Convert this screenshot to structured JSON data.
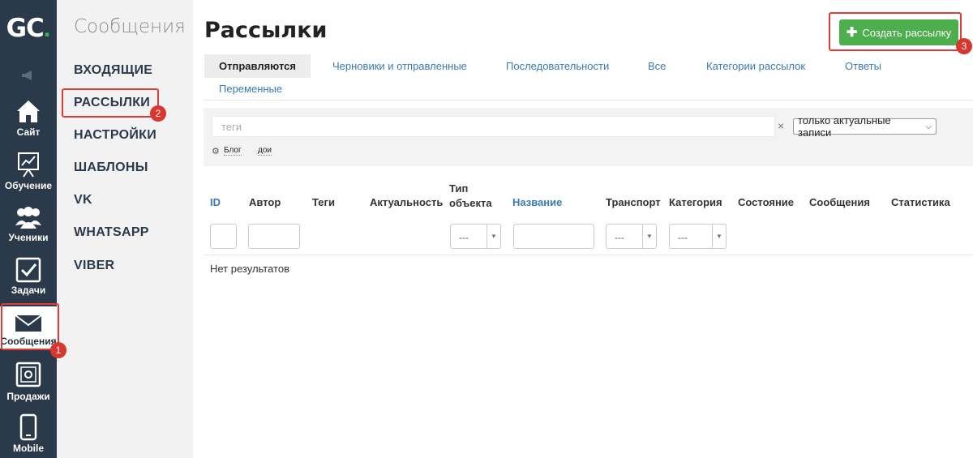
{
  "rail": {
    "logo_text": "GC",
    "logo_dot": ".",
    "items": [
      {
        "label": "Сайт",
        "icon": "home-icon"
      },
      {
        "label": "Обучение",
        "icon": "presentation-chart-icon"
      },
      {
        "label": "Ученики",
        "icon": "users-icon"
      },
      {
        "label": "Задачи",
        "icon": "checkbox-icon"
      },
      {
        "label": "Сообщения",
        "icon": "envelope-icon"
      },
      {
        "label": "Продажи",
        "icon": "safe-icon"
      },
      {
        "label": "Mobile",
        "icon": "smartphone-icon"
      }
    ]
  },
  "subnav": {
    "title": "Сообщения",
    "items": [
      "ВХОДЯЩИЕ",
      "РАССЫЛКИ",
      "НАСТРОЙКИ",
      "ШАБЛОНЫ",
      "VK",
      "WHATSAPP",
      "VIBER"
    ]
  },
  "main": {
    "title": "Рассылки",
    "create_button": "Создать рассылку",
    "tabs": [
      "Отправляются",
      "Черновики и отправленные",
      "Последовательности",
      "Все",
      "Категории рассылок",
      "Ответы",
      "Переменные"
    ],
    "filters": {
      "tags_placeholder": "теги",
      "clear": "×",
      "select_value": "только актуальные записи",
      "tag_chips": [
        "Блог",
        "дои"
      ]
    },
    "columns": [
      "ID",
      "Автор",
      "Теги",
      "Актуальность",
      "Тип объекта",
      "Название",
      "Транспорт",
      "Категория",
      "Состояние",
      "Сообщения",
      "Статистика"
    ],
    "column_filter_placeholder": "---",
    "empty_text": "Нет результатов"
  },
  "annotations": [
    "1",
    "2",
    "3"
  ],
  "colors": {
    "rail_bg": "#2b3a4a",
    "accent_green": "#4cae4c",
    "link_blue": "#3a79b7",
    "callout_red": "#e03b37"
  }
}
